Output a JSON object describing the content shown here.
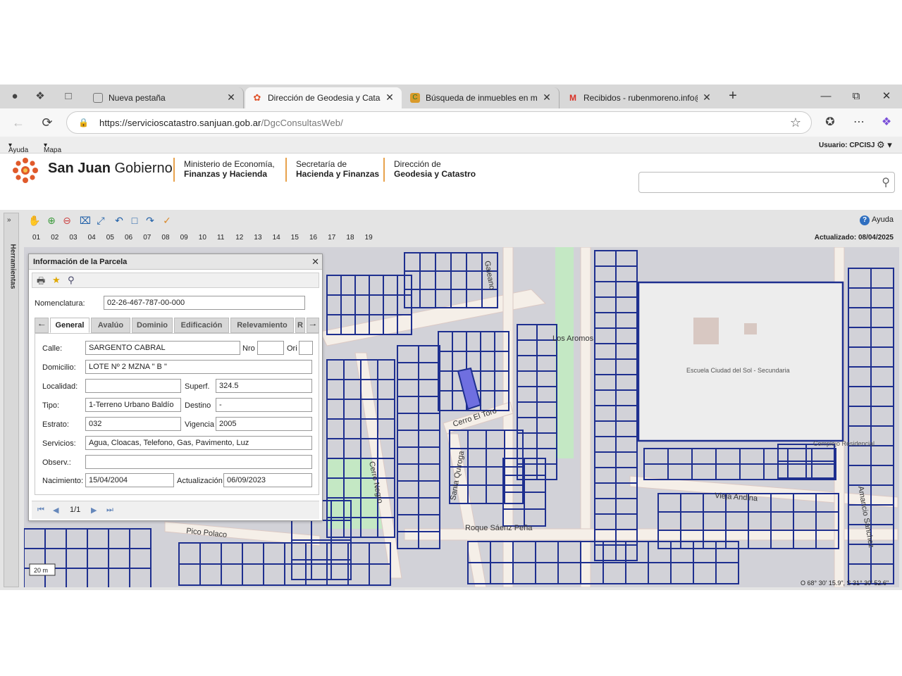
{
  "browser": {
    "tabs": [
      {
        "title": "Nueva pestaña",
        "favicon": "page-icon"
      },
      {
        "title": "Dirección de Geodesia y Catastro",
        "favicon": "san-juan-icon"
      },
      {
        "title": "Búsqueda de inmuebles en mapa",
        "favicon": "map-site-icon"
      },
      {
        "title": "Recibidos - rubenmoreno.info@g",
        "favicon": "gmail-icon"
      }
    ],
    "url_host": "https://servicioscatastro.sanjuan.gob.ar",
    "url_path": "/DgcConsultasWeb/"
  },
  "appmenu": {
    "ayuda": "Ayuda",
    "mapa": "Mapa",
    "usuario": "Usuario: CPCISJ"
  },
  "header": {
    "brand_bold": "San Juan",
    "brand_light": "Gobierno",
    "ministerio_1": "Ministerio de Economía,",
    "ministerio_2": "Finanzas y Hacienda",
    "secretaria_1": "Secretaría de",
    "secretaria_2": "Hacienda y Finanzas",
    "direccion_1": "Dirección de",
    "direccion_2": "Geodesia y Catastro"
  },
  "sidebar": {
    "label": "Herramientas"
  },
  "toolbar": {
    "ayuda": "Ayuda",
    "numbers": [
      "01",
      "02",
      "03",
      "04",
      "05",
      "06",
      "07",
      "08",
      "09",
      "10",
      "11",
      "12",
      "13",
      "14",
      "15",
      "16",
      "17",
      "18",
      "19"
    ],
    "updated": "Actualizado: 08/04/2025"
  },
  "map": {
    "streets": [
      "Galeano",
      "Los Aromos",
      "Cerro El Toro",
      "Cerro Negro",
      "Santa Quiroga",
      "Roque Sáenz Peña",
      "Pico Polaco",
      "Amancio Sánchez",
      "Vieja Andina"
    ],
    "poi": [
      "Escuela Ciudad del Sol - Secundaria",
      "Complejo Residencial"
    ],
    "scale": "20 m",
    "coords": "O 68° 30' 15.9\", S 31° 30' 52.6\""
  },
  "panel": {
    "title": "Información de la Parcela",
    "nomenclatura_label": "Nomenclatura:",
    "nomenclatura": "02-26-467-787-00-000",
    "tabs": [
      "General",
      "Avalúo",
      "Dominio",
      "Edificación",
      "Relevamiento",
      "R"
    ],
    "labels": {
      "calle": "Calle:",
      "nro": "Nro",
      "ori": "Ori",
      "domicilio": "Domicilio:",
      "localidad": "Localidad:",
      "superf": "Superf.",
      "tipo": "Tipo:",
      "destino": "Destino",
      "estrato": "Estrato:",
      "vigencia": "Vigencia",
      "servicios": "Servicios:",
      "observ": "Observ.:",
      "nacimiento": "Nacimiento:",
      "actualizacion": "Actualización"
    },
    "values": {
      "calle": "SARGENTO CABRAL",
      "nro": "",
      "ori": "",
      "domicilio": "LOTE Nº 2 MZNA \" B \"",
      "localidad": "",
      "superf": "324.5",
      "tipo": "1-Terreno Urbano Baldío",
      "destino": "-",
      "estrato": "032",
      "vigencia": "2005",
      "servicios": "Agua, Cloacas, Telefono, Gas, Pavimento, Luz",
      "observ": "",
      "nacimiento": "15/04/2004",
      "actualizacion": "06/09/2023"
    },
    "pager": "1/1"
  },
  "colors": {
    "parcel_line": "#1e2f8f",
    "selected_parcel": "#6f6fe0",
    "map_fill": "#d2d2d8",
    "road": "#f5efe8",
    "green": "#c4e8c4"
  }
}
